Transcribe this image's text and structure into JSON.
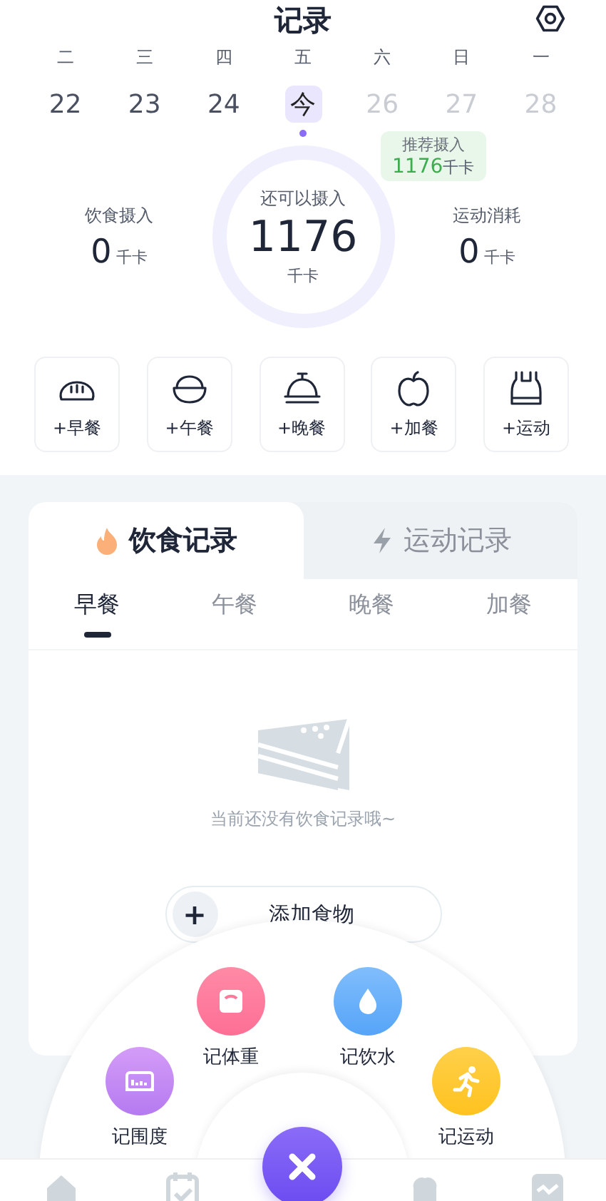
{
  "title": "记录",
  "week": [
    {
      "weekday": "二",
      "date": "22",
      "selected": false,
      "disabled": false
    },
    {
      "weekday": "三",
      "date": "23",
      "selected": false,
      "disabled": false
    },
    {
      "weekday": "四",
      "date": "24",
      "selected": false,
      "disabled": false
    },
    {
      "weekday": "五",
      "date": "今",
      "selected": true,
      "disabled": false
    },
    {
      "weekday": "六",
      "date": "26",
      "selected": false,
      "disabled": true
    },
    {
      "weekday": "日",
      "date": "27",
      "selected": false,
      "disabled": true
    },
    {
      "weekday": "一",
      "date": "28",
      "selected": false,
      "disabled": true
    }
  ],
  "recommended": {
    "label": "推荐摄入",
    "value": "1176",
    "unit": "千卡"
  },
  "intake": {
    "label": "饮食摄入",
    "value": "0",
    "unit": "千卡"
  },
  "remaining": {
    "label": "还可以摄入",
    "value": "1176",
    "unit": "千卡"
  },
  "burned": {
    "label": "运动消耗",
    "value": "0",
    "unit": "千卡"
  },
  "quick_add": [
    {
      "label": "+早餐",
      "kind": "bread"
    },
    {
      "label": "+午餐",
      "kind": "bowl"
    },
    {
      "label": "+晚餐",
      "kind": "cloche"
    },
    {
      "label": "+加餐",
      "kind": "apple"
    },
    {
      "label": "+运动",
      "kind": "vest"
    }
  ],
  "record_tabs": [
    {
      "label": "饮食记录",
      "kind": "food",
      "selected": true
    },
    {
      "label": "运动记录",
      "kind": "sport",
      "selected": false
    }
  ],
  "meal_tabs": [
    {
      "label": "早餐",
      "selected": true
    },
    {
      "label": "午餐",
      "selected": false
    },
    {
      "label": "晚餐",
      "selected": false
    },
    {
      "label": "加餐",
      "selected": false
    }
  ],
  "empty_message": "当前还没有饮食记录哦~",
  "add_button": {
    "icon": "+",
    "label": "添加食物"
  },
  "radial_menu": [
    {
      "label": "记体重",
      "kind": "weight"
    },
    {
      "label": "记饮水",
      "kind": "water"
    },
    {
      "label": "记围度",
      "kind": "girth"
    },
    {
      "label": "记运动",
      "kind": "run"
    }
  ]
}
